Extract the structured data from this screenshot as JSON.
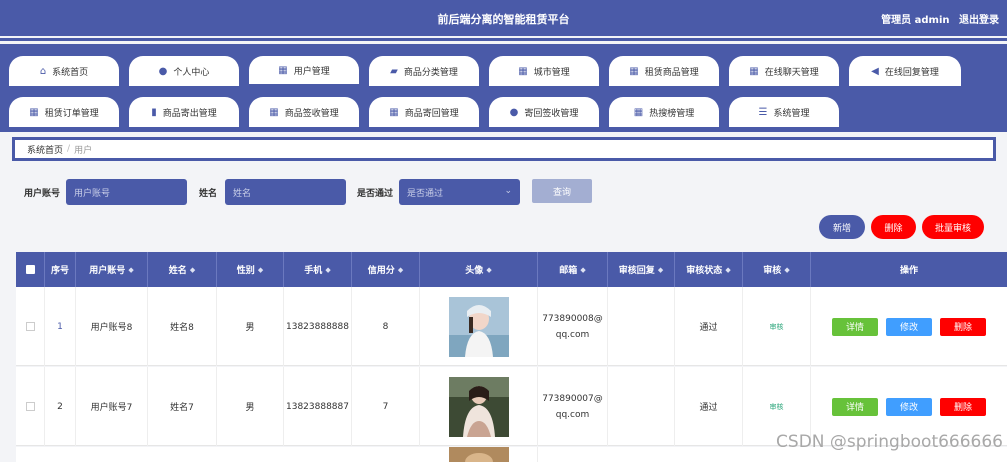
{
  "header": {
    "title": "前后端分离的智能租赁平台",
    "user_label": "管理员 admin",
    "logout_label": "退出登录"
  },
  "nav": {
    "tabs": [
      {
        "label": "系统首页",
        "icon": "home-icon"
      },
      {
        "label": "个人中心",
        "icon": "person-icon"
      },
      {
        "label": "用户管理",
        "icon": "grid-icon",
        "active": true
      },
      {
        "label": "商品分类管理",
        "icon": "category-icon"
      },
      {
        "label": "城市管理",
        "icon": "grid-icon"
      },
      {
        "label": "租赁商品管理",
        "icon": "grid-icon"
      },
      {
        "label": "在线聊天管理",
        "icon": "grid-icon"
      },
      {
        "label": "在线回复管理",
        "icon": "reply-icon"
      },
      {
        "label": "租赁订单管理",
        "icon": "grid-icon"
      },
      {
        "label": "商品寄出管理",
        "icon": "bar-chart-icon"
      },
      {
        "label": "商品签收管理",
        "icon": "grid-icon"
      },
      {
        "label": "商品寄回管理",
        "icon": "grid-icon"
      },
      {
        "label": "寄回签收管理",
        "icon": "location-icon"
      },
      {
        "label": "热搜榜管理",
        "icon": "grid-icon"
      },
      {
        "label": "系统管理",
        "icon": "settings-icon"
      }
    ]
  },
  "breadcrumb": {
    "home": "系统首页",
    "separator": "/",
    "current": "用户"
  },
  "filters": {
    "account_label": "用户账号",
    "account_placeholder": "用户账号",
    "name_label": "姓名",
    "name_placeholder": "姓名",
    "passed_label": "是否通过",
    "passed_placeholder": "是否通过",
    "search_label": "查询"
  },
  "actions": {
    "add": "新增",
    "delete": "删除",
    "batch_audit": "批量审核"
  },
  "colors": {
    "primary": "#4a5aa8",
    "danger": "#ff0000",
    "success": "#67c23a",
    "info": "#409eff"
  },
  "table": {
    "headers": [
      "",
      "序号",
      "用户账号",
      "姓名",
      "性别",
      "手机",
      "信用分",
      "头像",
      "邮箱",
      "审核回复",
      "审核状态",
      "审核",
      "操作"
    ],
    "rows": [
      {
        "index": "1",
        "account": "用户账号8",
        "name": "姓名8",
        "gender": "男",
        "phone": "13823888888",
        "credit": "8",
        "email": "773890008@qq.com",
        "reply": "",
        "status": "通过",
        "audit": "审核",
        "detail": "详情",
        "edit": "修改",
        "delete": "删除"
      },
      {
        "index": "2",
        "account": "用户账号7",
        "name": "姓名7",
        "gender": "男",
        "phone": "13823888887",
        "credit": "7",
        "email": "773890007@qq.com",
        "reply": "",
        "status": "通过",
        "audit": "审核",
        "detail": "详情",
        "edit": "修改",
        "delete": "删除"
      }
    ]
  },
  "watermark": "CSDN @springboot666666"
}
